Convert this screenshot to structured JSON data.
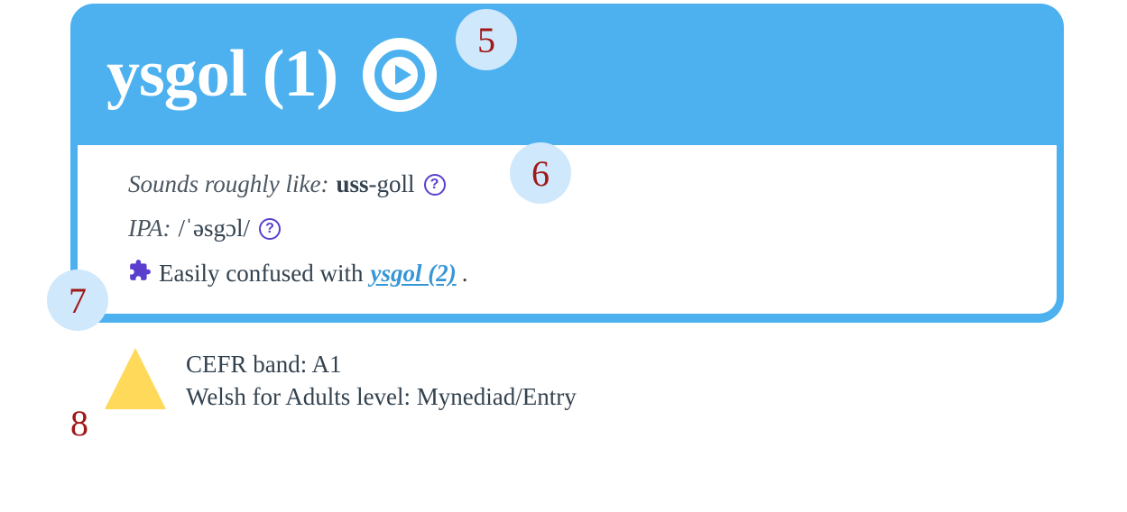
{
  "header": {
    "headword": "ysgol (1)"
  },
  "pron": {
    "sounds_label": "Sounds roughly like:",
    "syll_strong": "uss",
    "syll_rest": "-goll",
    "ipa_label": "IPA:",
    "ipa_value": "/ˈəsgɔl/"
  },
  "confused": {
    "prefix": "Easily confused with",
    "link": "ysgol (2)",
    "suffix": "."
  },
  "levels": {
    "cefr_label": "CEFR band:",
    "cefr_value": "A1",
    "wfa_label": "Welsh for Adults level:",
    "wfa_value": "Mynediad/Entry"
  },
  "callouts": {
    "c5": "5",
    "c6": "6",
    "c7": "7",
    "c8": "8"
  },
  "help_glyph": "?"
}
